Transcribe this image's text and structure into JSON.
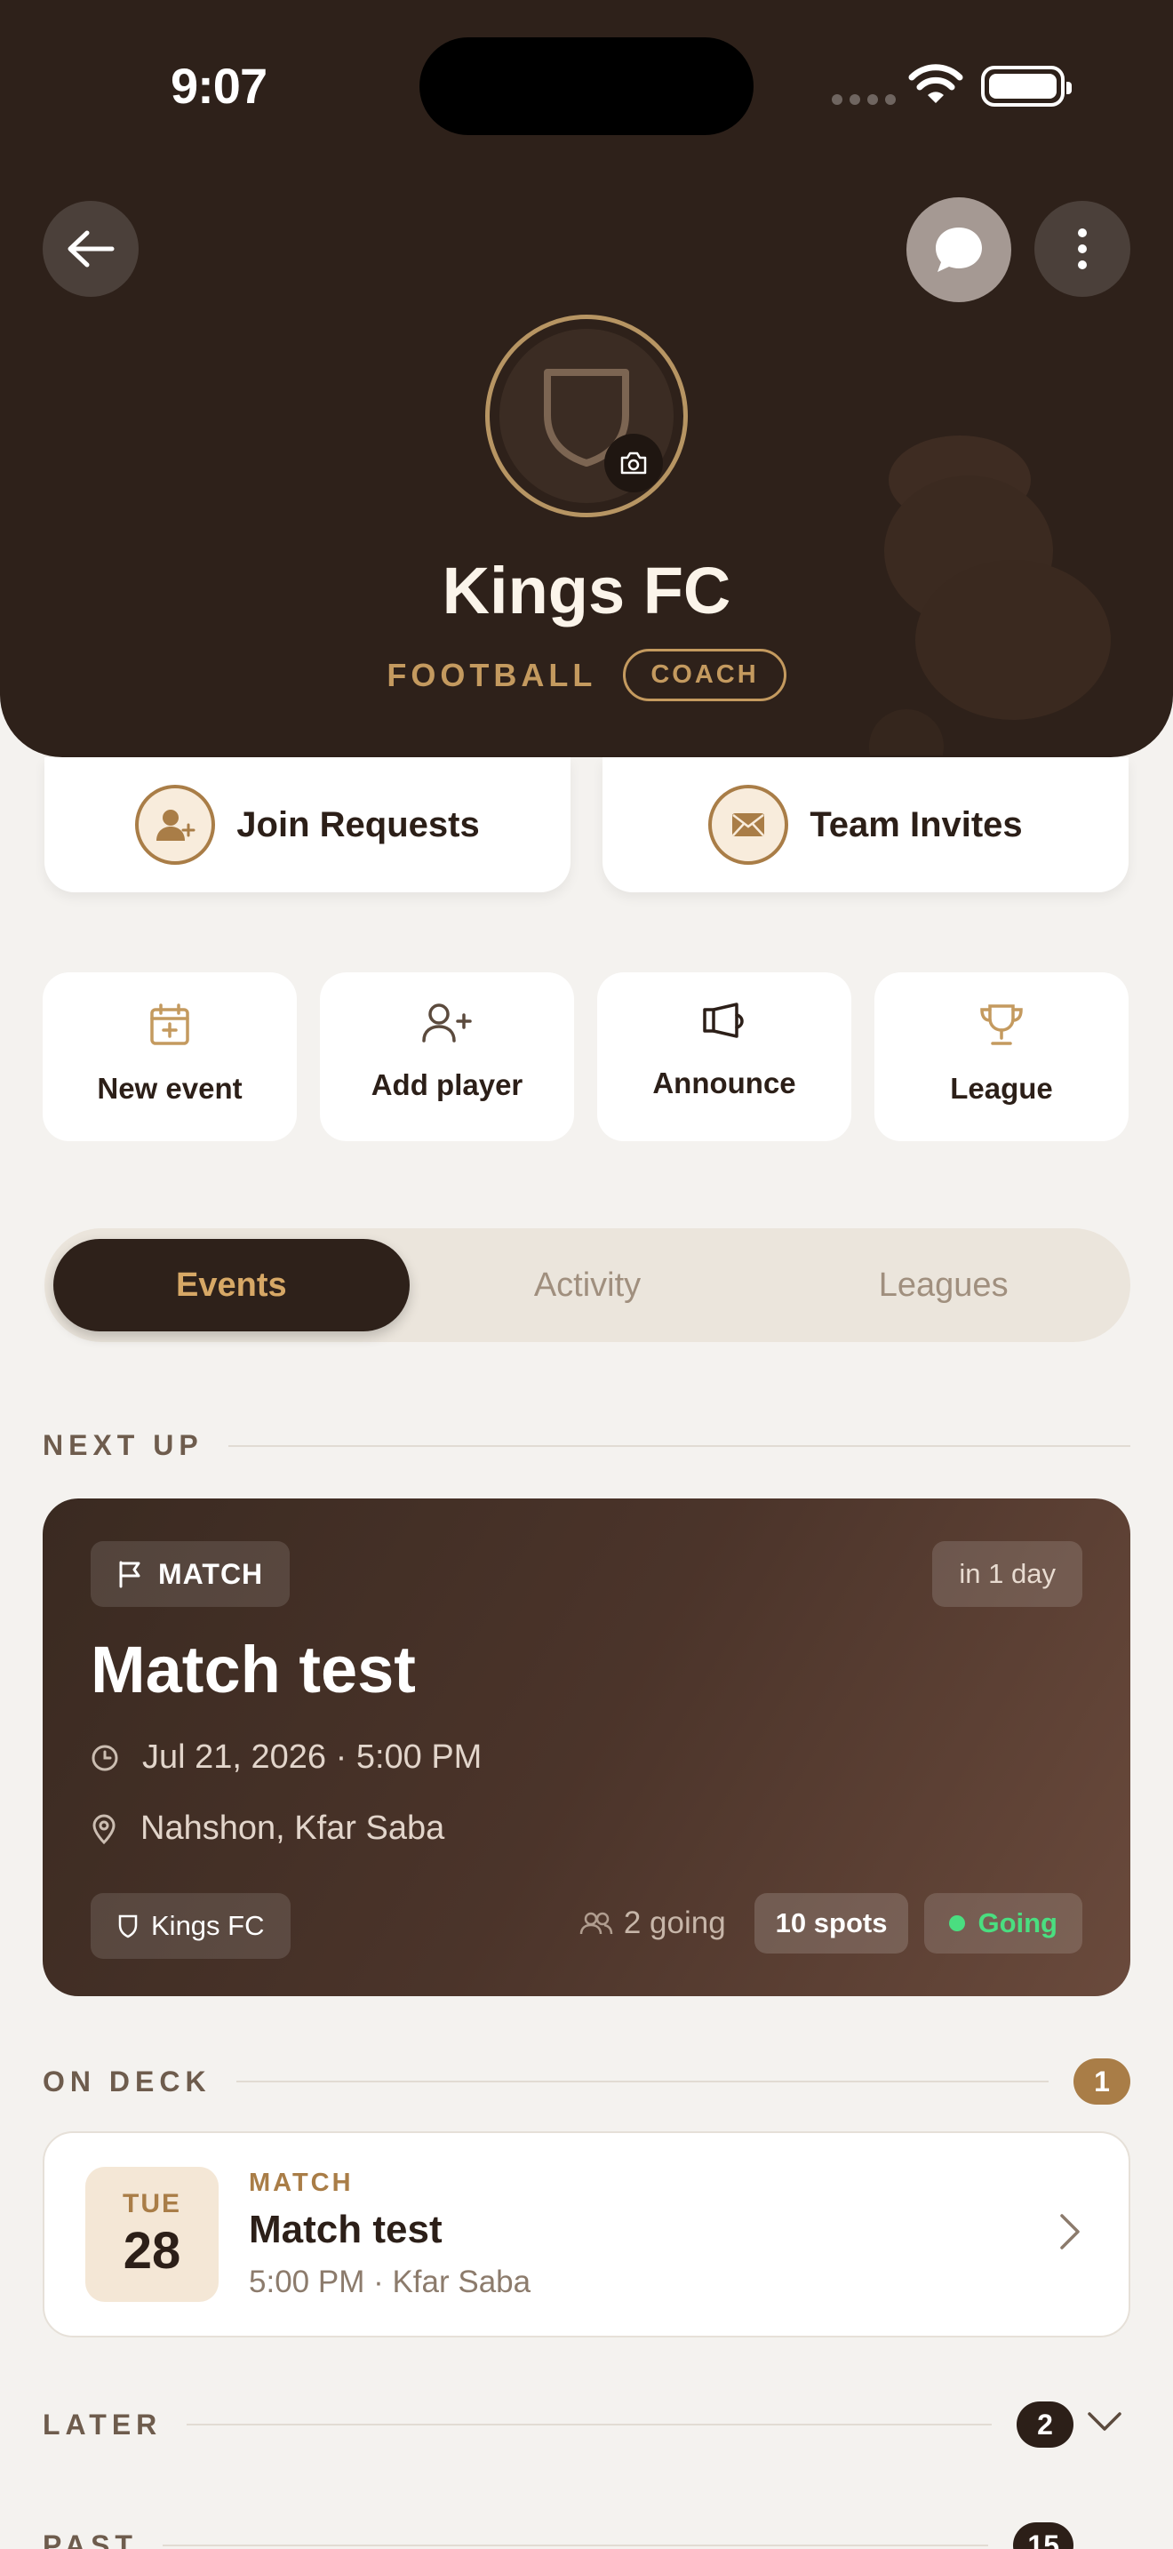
{
  "status_bar": {
    "time": "9:07"
  },
  "header": {
    "team_name": "Kings FC",
    "sport": "FOOTBALL",
    "role": "COACH"
  },
  "requests": {
    "join_label": "Join Requests",
    "invites_label": "Team Invites"
  },
  "quick_actions": [
    {
      "label": "New event",
      "icon": "calendar-plus-icon"
    },
    {
      "label": "Add player",
      "icon": "user-plus-icon"
    },
    {
      "label": "Announce",
      "icon": "megaphone-icon"
    },
    {
      "label": "League",
      "icon": "trophy-icon"
    }
  ],
  "tabs": [
    {
      "label": "Events",
      "active": true
    },
    {
      "label": "Activity",
      "active": false
    },
    {
      "label": "Leagues",
      "active": false
    }
  ],
  "next_up": {
    "section_title": "NEXT UP",
    "type": "MATCH",
    "relative_time": "in 1 day",
    "title": "Match test",
    "datetime": "Jul 21, 2026 · 5:00 PM",
    "location": "Nahshon, Kfar Saba",
    "team": "Kings FC",
    "going": "2 going",
    "spots": "10 spots",
    "status": "Going"
  },
  "on_deck": {
    "section_title": "ON DECK",
    "count": "1",
    "events": [
      {
        "dow": "TUE",
        "day": "28",
        "type": "MATCH",
        "title": "Match test",
        "meta": "5:00 PM · Kfar Saba"
      }
    ]
  },
  "later": {
    "section_title": "LATER",
    "count": "2"
  },
  "past": {
    "section_title": "PAST",
    "count": "15"
  },
  "colors": {
    "header_bg": "#2e211a",
    "accent_gold": "#c49a5f",
    "going_green": "#4ade80",
    "page_bg": "#f4f2ef"
  }
}
